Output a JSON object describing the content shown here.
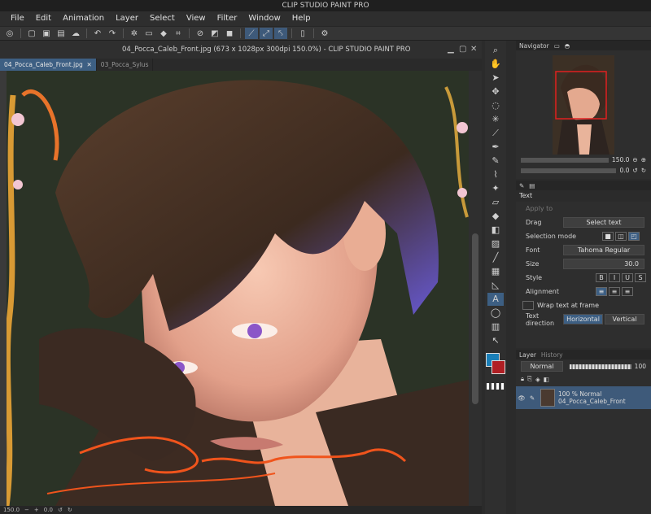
{
  "app": {
    "title": "CLIP STUDIO PAINT PRO"
  },
  "menu": [
    "File",
    "Edit",
    "Animation",
    "Layer",
    "Select",
    "View",
    "Filter",
    "Window",
    "Help"
  ],
  "document": {
    "title": "04_Pocca_Caleb_Front.jpg (673 x 1028px 300dpi 150.0%)  - CLIP STUDIO PAINT PRO",
    "tabs": [
      "04_Pocca_Caleb_Front.jpg",
      "03_Pocca_Sylus"
    ],
    "zoom": "150.0",
    "rotation": "0.0"
  },
  "navigator": {
    "tab": "Navigator",
    "zoom": "150.0",
    "angle": "0.0"
  },
  "tool_property": {
    "title": "Text",
    "apply_to": "Apply to",
    "drag_label": "Drag",
    "drag_value": "Select text",
    "selection_mode": "Selection mode",
    "font_label": "Font",
    "font_value": "Tahoma Regular",
    "size_label": "Size",
    "size_value": "30.0",
    "style_label": "Style",
    "style_buttons": [
      "B",
      "I",
      "U",
      "S"
    ],
    "alignment_label": "Alignment",
    "wrap": "Wrap text at frame",
    "direction_label": "Text direction",
    "direction_options": [
      "Horizontal",
      "Vertical"
    ]
  },
  "layers": {
    "tabs": [
      "Layer",
      "History"
    ],
    "blend_mode": "Normal",
    "opacity": "100",
    "items": [
      {
        "mode": "100 % Normal",
        "name": "04_Pocca_Caleb_Front"
      }
    ]
  },
  "colors": {
    "main": "#1a7fb8",
    "sub": "#b01f24",
    "accent": "#3d5f83"
  }
}
